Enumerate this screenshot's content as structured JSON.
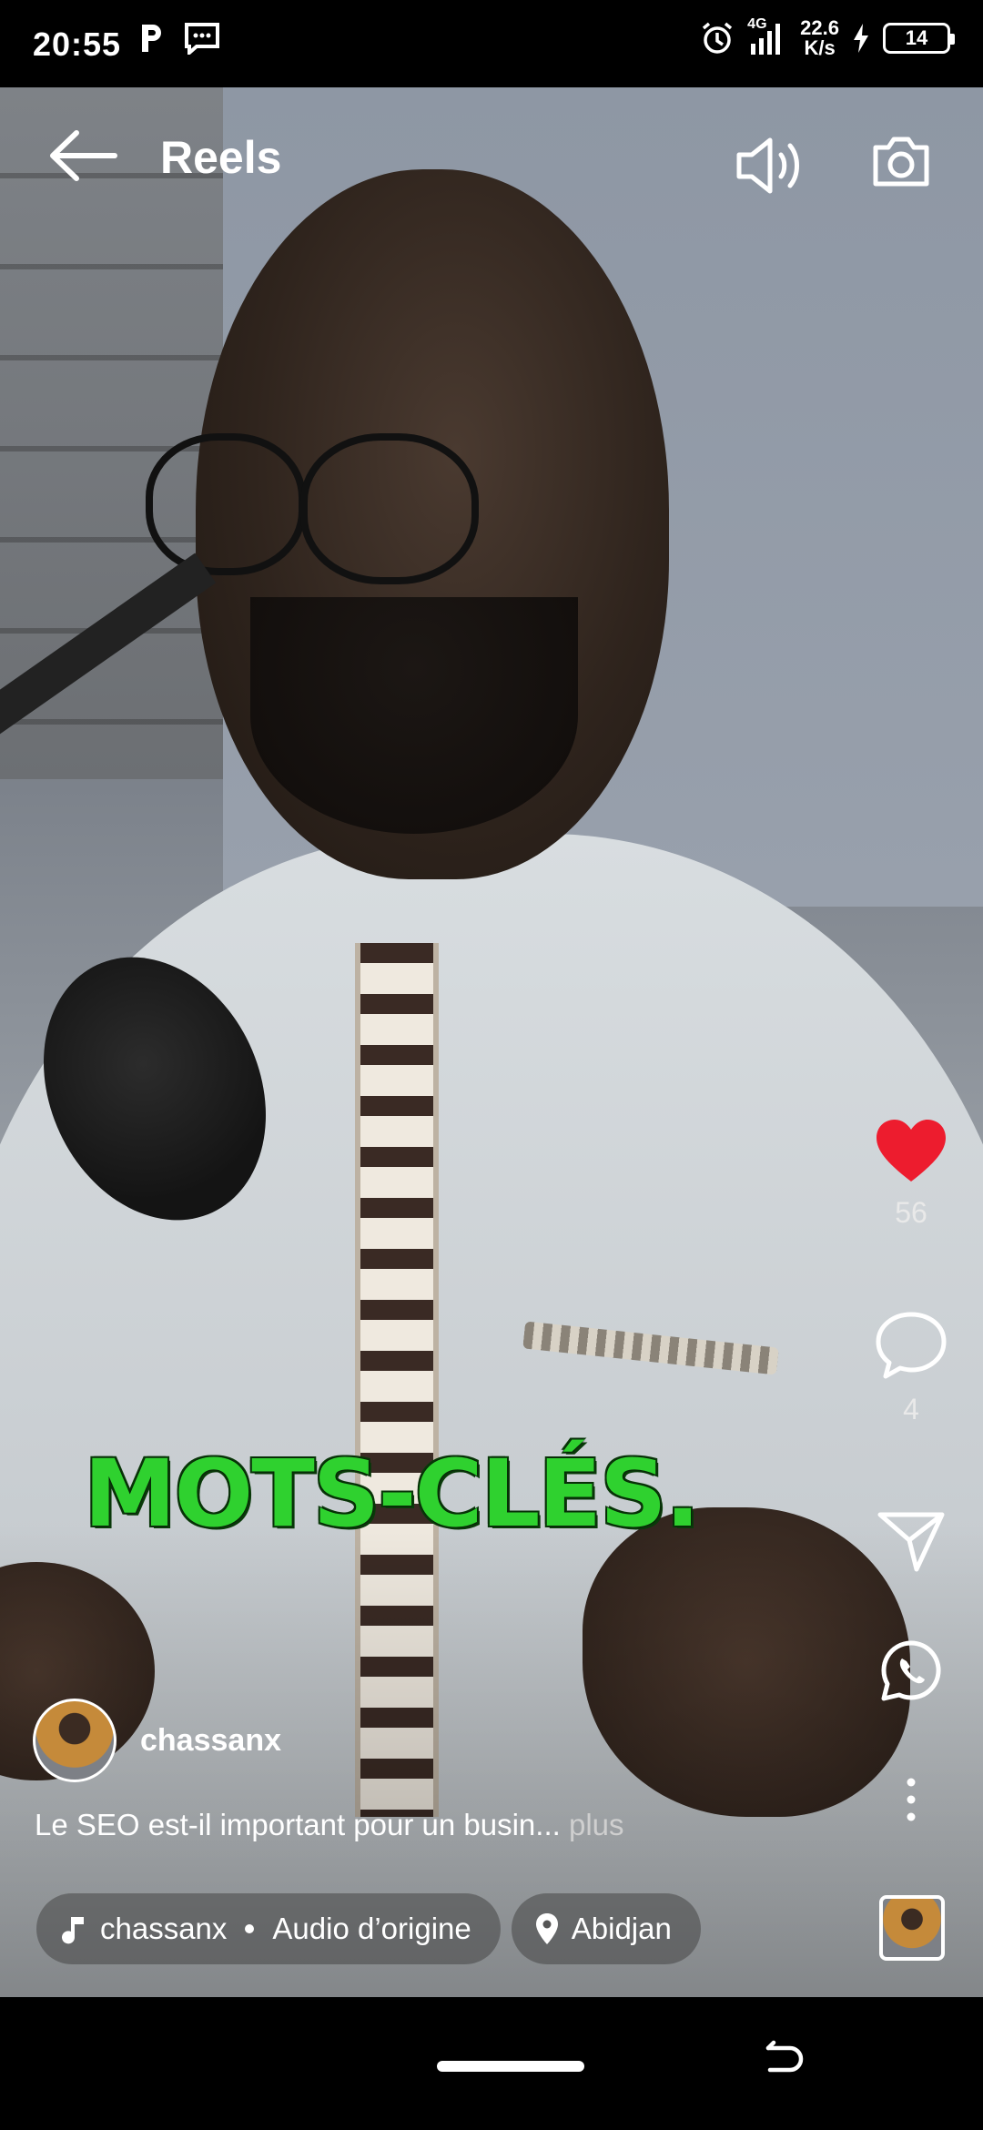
{
  "status_bar": {
    "time": "20:55",
    "network": "4G",
    "speed_value": "22.6",
    "speed_unit": "K/s",
    "battery": "14"
  },
  "header": {
    "title": "Reels",
    "back_icon": "arrow-left-icon",
    "sound_icon": "volume-icon",
    "camera_icon": "camera-icon"
  },
  "video": {
    "caption_text": "MOTS-CLÉS.",
    "caption_color": "#2fd12f"
  },
  "actions": {
    "likes": "56",
    "comments": "4",
    "like_color": "#ed1c2e"
  },
  "post": {
    "username": "chassanx",
    "description": "Le SEO est-il important pour un busin...",
    "more_label": " plus",
    "audio_author": "chassanx",
    "audio_label": "Audio d’origine",
    "location": "Abidjan"
  }
}
